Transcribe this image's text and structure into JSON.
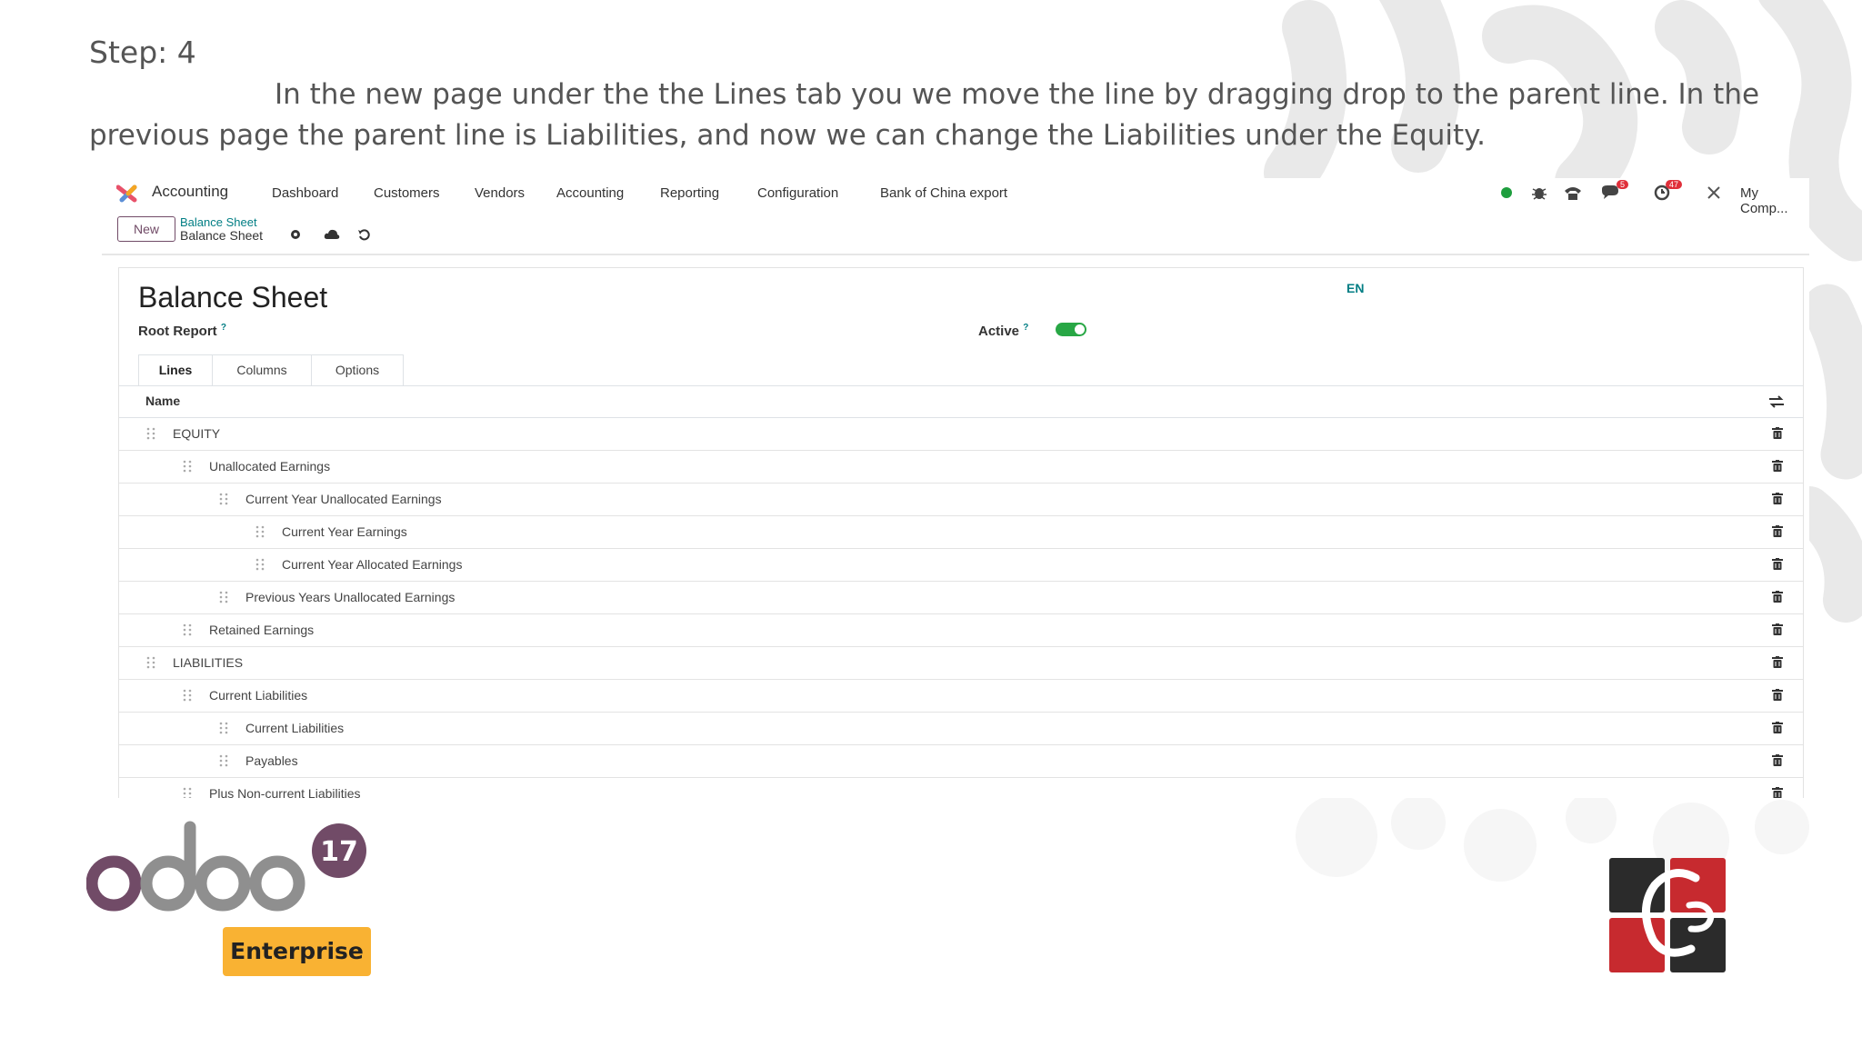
{
  "slide": {
    "step": "Step: 4",
    "instruction": "In the new page under the the Lines tab you we move the line by dragging drop to the parent line. In the previous page the parent line is Liabilities, and now we can change the Liabilities under the Equity."
  },
  "navbar": {
    "app_name": "Accounting",
    "menu": [
      "Dashboard",
      "Customers",
      "Vendors",
      "Accounting",
      "Reporting",
      "Configuration",
      "Bank of China export"
    ],
    "messages_badge": "5",
    "activity_badge": "47",
    "company": "My Comp..."
  },
  "control": {
    "new_label": "New",
    "breadcrumb_parent": "Balance Sheet",
    "breadcrumb_current": "Balance Sheet"
  },
  "form": {
    "title": "Balance Sheet",
    "lang": "EN",
    "root_report_label": "Root Report",
    "active_label": "Active",
    "help_mark": "?",
    "active": true
  },
  "tabs": [
    {
      "label": "Lines",
      "active": true
    },
    {
      "label": "Columns",
      "active": false
    },
    {
      "label": "Options",
      "active": false
    }
  ],
  "grid": {
    "name_header": "Name",
    "rows": [
      {
        "label": "EQUITY",
        "level": 0
      },
      {
        "label": "Unallocated Earnings",
        "level": 1
      },
      {
        "label": "Current Year Unallocated Earnings",
        "level": 2
      },
      {
        "label": "Current Year Earnings",
        "level": 3
      },
      {
        "label": "Current Year Allocated Earnings",
        "level": 3
      },
      {
        "label": "Previous Years Unallocated Earnings",
        "level": 2
      },
      {
        "label": "Retained Earnings",
        "level": 1
      },
      {
        "label": "LIABILITIES",
        "level": 0
      },
      {
        "label": "Current Liabilities",
        "level": 1
      },
      {
        "label": "Current Liabilities",
        "level": 2
      },
      {
        "label": "Payables",
        "level": 2
      },
      {
        "label": "Plus Non-current Liabilities",
        "level": 1
      }
    ]
  },
  "branding": {
    "odoo_text": "odoo",
    "odoo_version": "17",
    "enterprise_label": "Enterprise"
  },
  "colors": {
    "odoo_purple": "#714b67",
    "enterprise_yellow": "#f9b233",
    "teal_link": "#017e84",
    "toggle_green": "#28a745"
  }
}
